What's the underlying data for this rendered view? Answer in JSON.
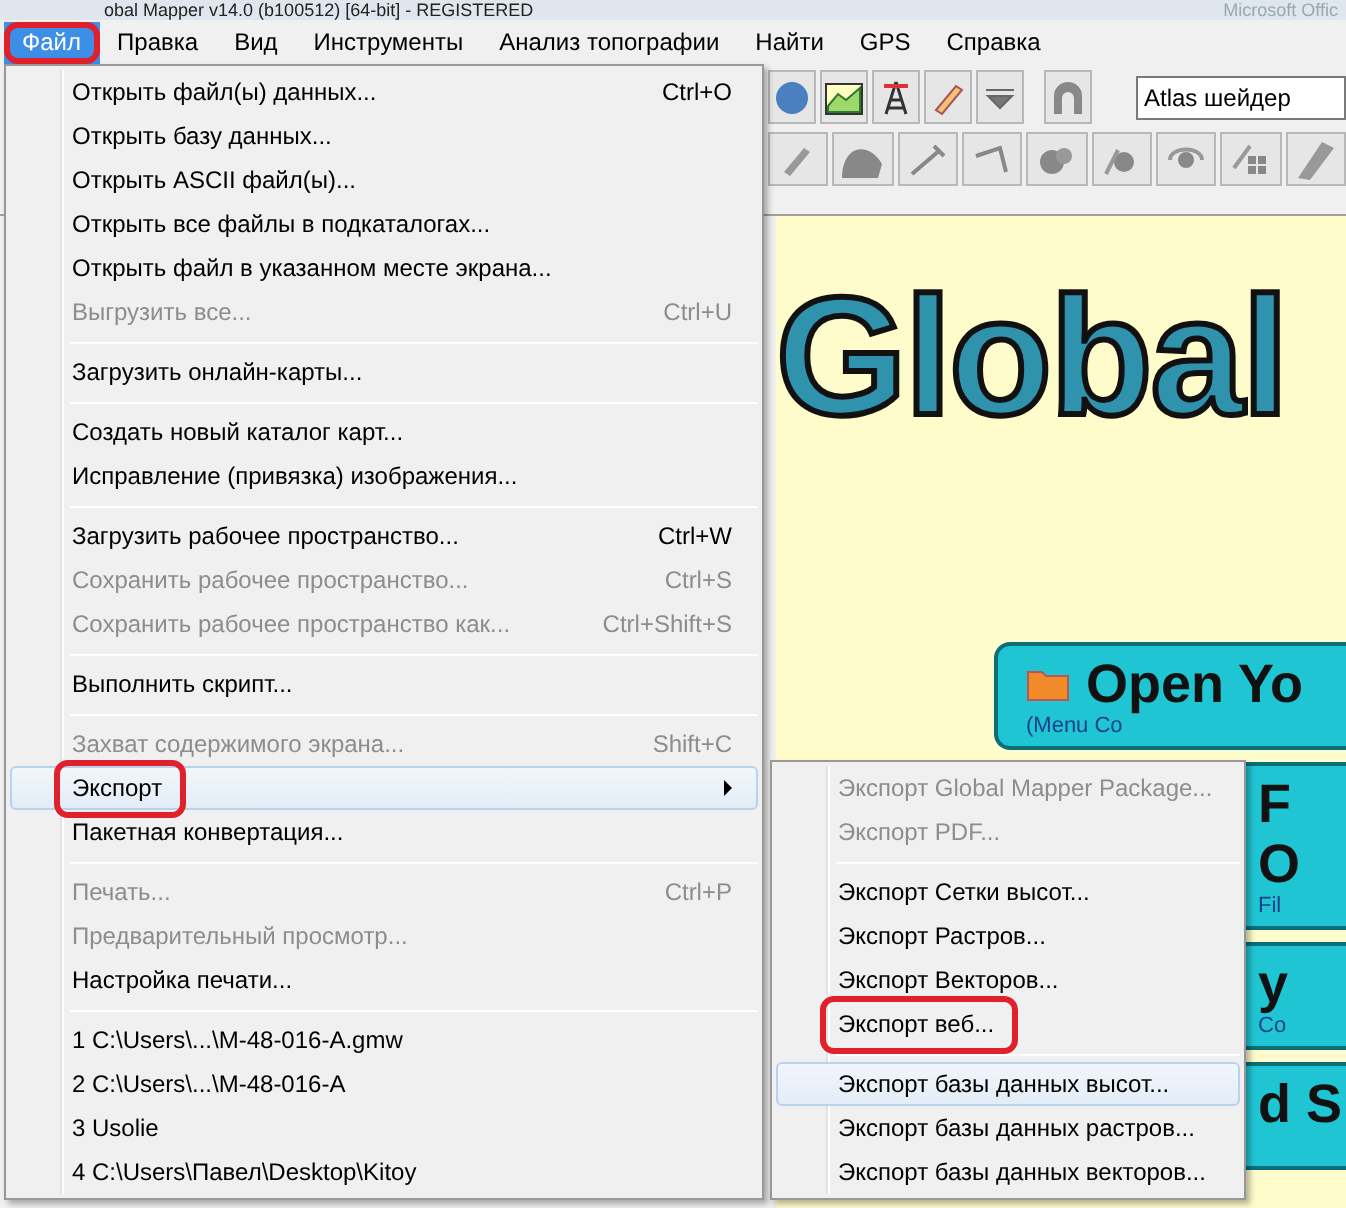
{
  "window": {
    "title": "obal Mapper v14.0 (b100512) [64-bit] - REGISTERED",
    "background_title": "Microsoft Offic"
  },
  "menu_bar": [
    {
      "label": "Файл",
      "selected": true,
      "circled": true
    },
    {
      "label": "Правка",
      "selected": false,
      "circled": false
    },
    {
      "label": "Вид",
      "selected": false,
      "circled": false
    },
    {
      "label": "Инструменты",
      "selected": false,
      "circled": false
    },
    {
      "label": "Анализ топографии",
      "selected": false,
      "circled": false
    },
    {
      "label": "Найти",
      "selected": false,
      "circled": false
    },
    {
      "label": "GPS",
      "selected": false,
      "circled": false
    },
    {
      "label": "Справка",
      "selected": false,
      "circled": false
    }
  ],
  "toolbar": {
    "shader_dropdown": {
      "value": "Atlas шейдер"
    }
  },
  "file_menu": {
    "items": [
      {
        "kind": "item",
        "label": "Открыть файл(ы) данных...",
        "shortcut": "Ctrl+O",
        "disabled": false,
        "selected": false,
        "circled": false
      },
      {
        "kind": "item",
        "label": "Открыть базу данных...",
        "disabled": false,
        "selected": false,
        "circled": false
      },
      {
        "kind": "item",
        "label": "Открыть ASCII файл(ы)...",
        "disabled": false,
        "selected": false,
        "circled": false
      },
      {
        "kind": "item",
        "label": "Открыть все файлы в подкаталогах...",
        "disabled": false,
        "selected": false,
        "circled": false
      },
      {
        "kind": "item",
        "label": "Открыть файл в указанном месте экрана...",
        "disabled": false,
        "selected": false,
        "circled": false
      },
      {
        "kind": "item",
        "label": "Выгрузить все...",
        "shortcut": "Ctrl+U",
        "disabled": true,
        "selected": false,
        "circled": false
      },
      {
        "kind": "separator"
      },
      {
        "kind": "item",
        "label": "Загрузить онлайн-карты...",
        "disabled": false,
        "selected": false,
        "circled": false
      },
      {
        "kind": "separator"
      },
      {
        "kind": "item",
        "label": "Создать новый каталог карт...",
        "disabled": false,
        "selected": false,
        "circled": false
      },
      {
        "kind": "item",
        "label": "Исправление (привязка) изображения...",
        "disabled": false,
        "selected": false,
        "circled": false
      },
      {
        "kind": "separator"
      },
      {
        "kind": "item",
        "label": "Загрузить рабочее пространство...",
        "shortcut": "Ctrl+W",
        "disabled": false,
        "selected": false,
        "circled": false
      },
      {
        "kind": "item",
        "label": "Сохранить рабочее пространство...",
        "shortcut": "Ctrl+S",
        "disabled": true,
        "selected": false,
        "circled": false
      },
      {
        "kind": "item",
        "label": "Сохранить рабочее пространство как...",
        "shortcut": "Ctrl+Shift+S",
        "disabled": true,
        "selected": false,
        "circled": false
      },
      {
        "kind": "separator"
      },
      {
        "kind": "item",
        "label": "Выполнить скрипт...",
        "disabled": false,
        "selected": false,
        "circled": false
      },
      {
        "kind": "separator"
      },
      {
        "kind": "item",
        "label": "Захват содержимого экрана...",
        "shortcut": "Shift+C",
        "disabled": true,
        "selected": false,
        "circled": false
      },
      {
        "kind": "submenu",
        "label": "Экспорт",
        "disabled": false,
        "selected": true,
        "circled": true
      },
      {
        "kind": "item",
        "label": "Пакетная конвертация...",
        "disabled": false,
        "selected": false,
        "circled": false
      },
      {
        "kind": "separator"
      },
      {
        "kind": "item",
        "label": "Печать...",
        "shortcut": "Ctrl+P",
        "disabled": true,
        "selected": false,
        "circled": false
      },
      {
        "kind": "item",
        "label": "Предварительный просмотр...",
        "disabled": true,
        "selected": false,
        "circled": false
      },
      {
        "kind": "item",
        "label": "Настройка печати...",
        "disabled": false,
        "selected": false,
        "circled": false
      },
      {
        "kind": "separator"
      },
      {
        "kind": "item",
        "label": "1 C:\\Users\\...\\M-48-016-A.gmw",
        "disabled": false,
        "selected": false,
        "circled": false
      },
      {
        "kind": "item",
        "label": "2 C:\\Users\\...\\M-48-016-A",
        "disabled": false,
        "selected": false,
        "circled": false
      },
      {
        "kind": "item",
        "label": "3 Usolie",
        "disabled": false,
        "selected": false,
        "circled": false
      },
      {
        "kind": "item",
        "label": "4 C:\\Users\\Павел\\Desktop\\Kitoy",
        "disabled": false,
        "selected": false,
        "circled": false
      }
    ]
  },
  "export_submenu": {
    "items": [
      {
        "kind": "item",
        "label": "Экспорт Global Mapper Package...",
        "disabled": true,
        "selected": false,
        "circled": false
      },
      {
        "kind": "item",
        "label": "Экспорт PDF...",
        "disabled": true,
        "selected": false,
        "circled": false
      },
      {
        "kind": "separator"
      },
      {
        "kind": "item",
        "label": "Экспорт Сетки высот...",
        "disabled": false,
        "selected": false,
        "circled": false
      },
      {
        "kind": "item",
        "label": "Экспорт Растров...",
        "disabled": false,
        "selected": false,
        "circled": false
      },
      {
        "kind": "item",
        "label": "Экспорт Векторов...",
        "disabled": false,
        "selected": false,
        "circled": false
      },
      {
        "kind": "item",
        "label": "Экспорт веб...",
        "disabled": false,
        "selected": false,
        "circled": true
      },
      {
        "kind": "separator"
      },
      {
        "kind": "item",
        "label": "Экспорт базы данных высот...",
        "disabled": false,
        "selected": true,
        "circled": false
      },
      {
        "kind": "item",
        "label": "Экспорт базы данных растров...",
        "disabled": false,
        "selected": false,
        "circled": false
      },
      {
        "kind": "item",
        "label": "Экспорт базы данных векторов...",
        "disabled": false,
        "selected": false,
        "circled": false
      }
    ]
  },
  "start_page": {
    "logo": "Global",
    "panels": [
      {
        "lines": [
          "Open Yo",
          "(Menu Co"
        ]
      },
      {
        "lines": [
          "F",
          "O",
          "Fil"
        ]
      },
      {
        "lines": [
          "y",
          "Co"
        ]
      },
      {
        "lines": [
          "d S"
        ]
      }
    ]
  }
}
